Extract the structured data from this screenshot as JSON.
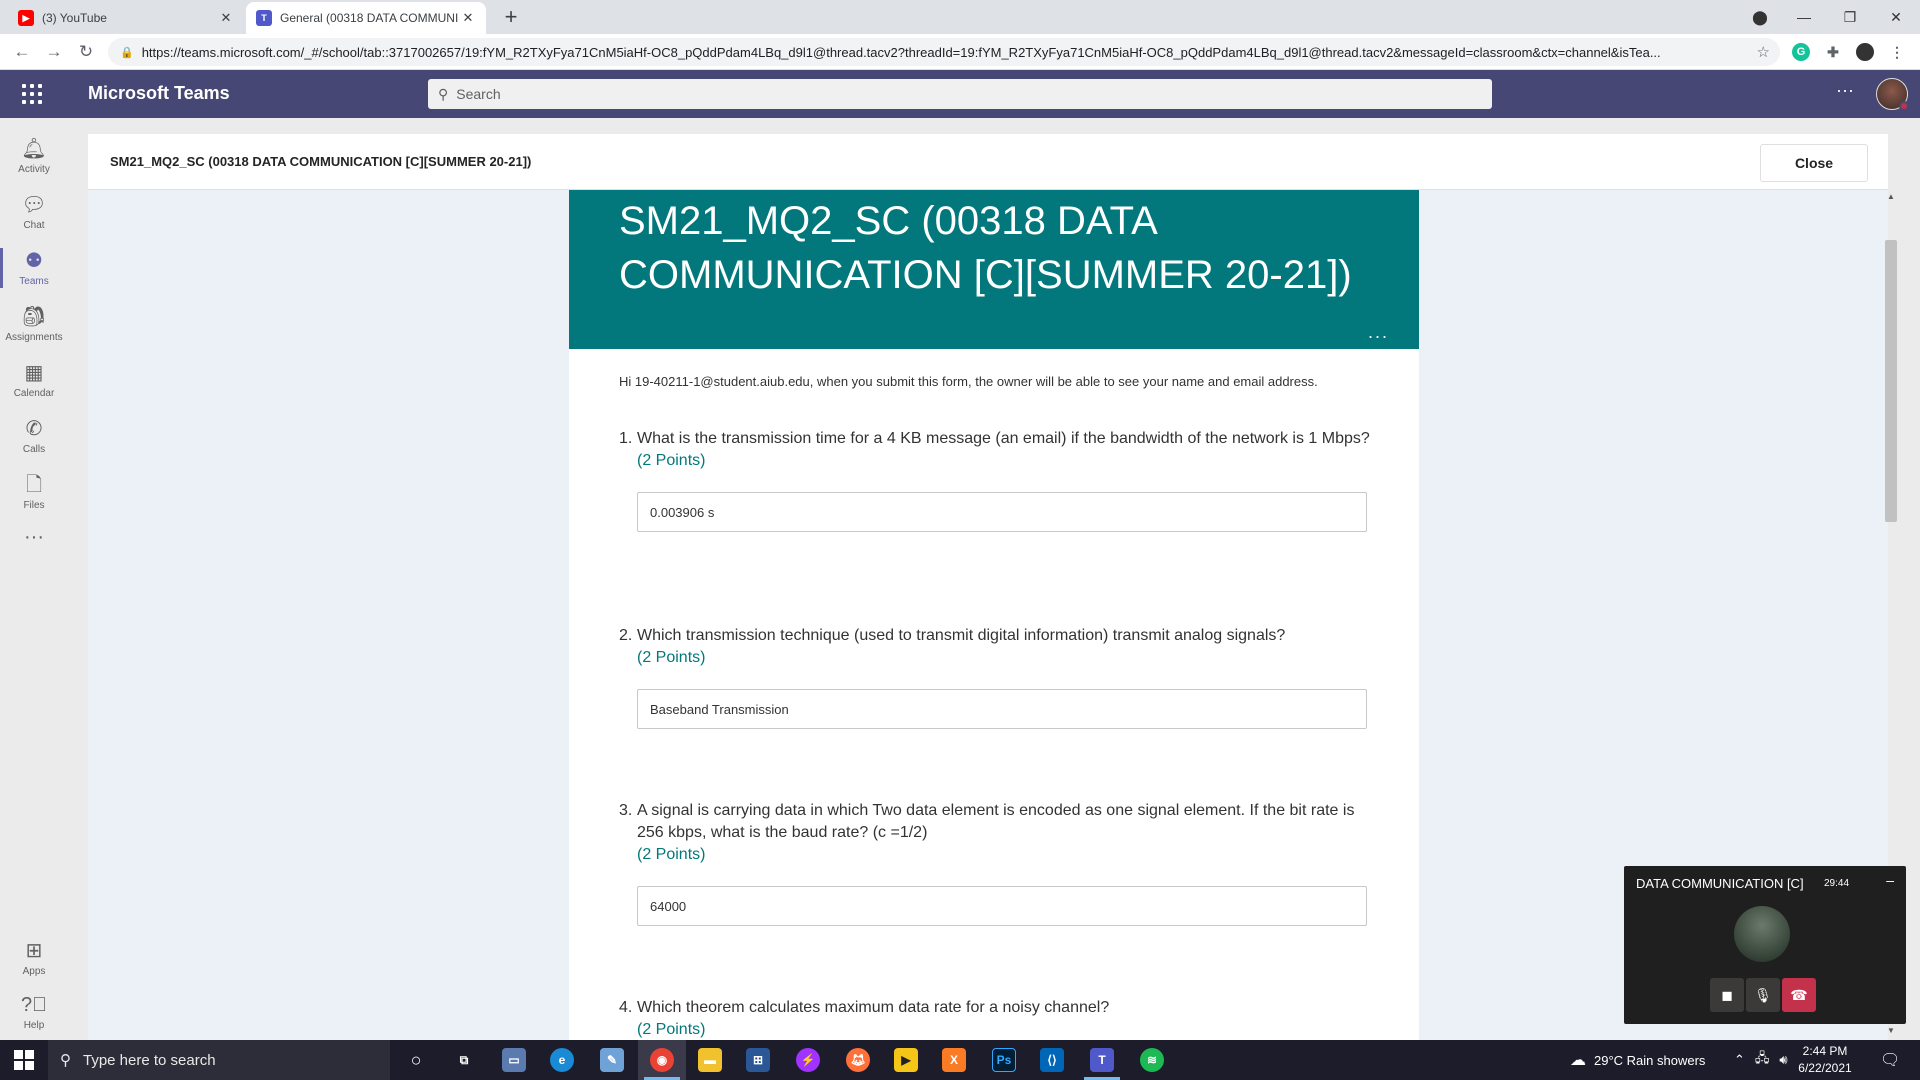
{
  "browser": {
    "tabs": [
      {
        "title": "(3) YouTube",
        "favicon": "youtube-icon",
        "active": false
      },
      {
        "title": "General (00318 DATA COMMUNI",
        "favicon": "teams-icon",
        "active": true
      }
    ],
    "url": "https://teams.microsoft.com/_#/school/tab::3717002657/19:fYM_R2TXyFya71CnM5iaHf-OC8_pQddPdam4LBq_d9l1@thread.tacv2?threadId=19:fYM_R2TXyFya71CnM5iaHf-OC8_pQddPdam4LBq_d9l1@thread.tacv2&messageId=classroom&ctx=channel&isTea..."
  },
  "teams": {
    "app_title": "Microsoft Teams",
    "search_placeholder": "Search",
    "more_label": "···"
  },
  "rail": {
    "items": [
      {
        "label": "Activity",
        "icon": "bell-icon"
      },
      {
        "label": "Chat",
        "icon": "chat-icon"
      },
      {
        "label": "Teams",
        "icon": "teams-icon"
      },
      {
        "label": "Assignments",
        "icon": "assignments-icon"
      },
      {
        "label": "Calendar",
        "icon": "calendar-icon"
      },
      {
        "label": "Calls",
        "icon": "phone-icon"
      },
      {
        "label": "Files",
        "icon": "file-icon"
      },
      {
        "label": "",
        "icon": "more-icon"
      },
      {
        "label": "Apps",
        "icon": "apps-icon"
      },
      {
        "label": "Help",
        "icon": "help-icon"
      }
    ]
  },
  "page": {
    "title": "SM21_MQ2_SC (00318 DATA COMMUNICATION [C][SUMMER 20-21])",
    "close_label": "Close"
  },
  "form": {
    "banner_title": "SM21_MQ2_SC (00318 DATA COMMUNICATION [C][SUMMER 20-21])",
    "banner_more": "...",
    "notice": "Hi 19-40211-1@student.aiub.edu, when you submit this form, the owner will be able to see your name and email address.",
    "questions": [
      {
        "num": "1.",
        "text": "What is the transmission time for a 4 KB message (an email) if the bandwidth of the network is 1 Mbps?",
        "points": "(2 Points)",
        "answer": "0.003906 s"
      },
      {
        "num": "2.",
        "text": "Which transmission technique (used to transmit digital information) transmit analog signals?",
        "points": "(2 Points)",
        "answer": "Baseband Transmission"
      },
      {
        "num": "3.",
        "text": "A signal is carrying data in which Two data element is encoded as one signal element. If the bit rate is 256 kbps, what is the baud rate? (c =1/2)",
        "points": "(2 Points)",
        "answer": "64000"
      },
      {
        "num": "4.",
        "text": "Which theorem calculates maximum data rate for a noisy channel?",
        "points": "(2 Points)",
        "answer": ""
      }
    ]
  },
  "call": {
    "title": "DATA COMMUNICATION [C]",
    "time": "29:44"
  },
  "taskbar": {
    "search_placeholder": "Type here to search",
    "weather": "29°C  Rain showers",
    "time": "2:44 PM",
    "date": "6/22/2021"
  },
  "colors": {
    "teams_header": "#464775",
    "form_banner": "#03787c",
    "points_text": "#03787c",
    "hangup": "#c4314b"
  }
}
